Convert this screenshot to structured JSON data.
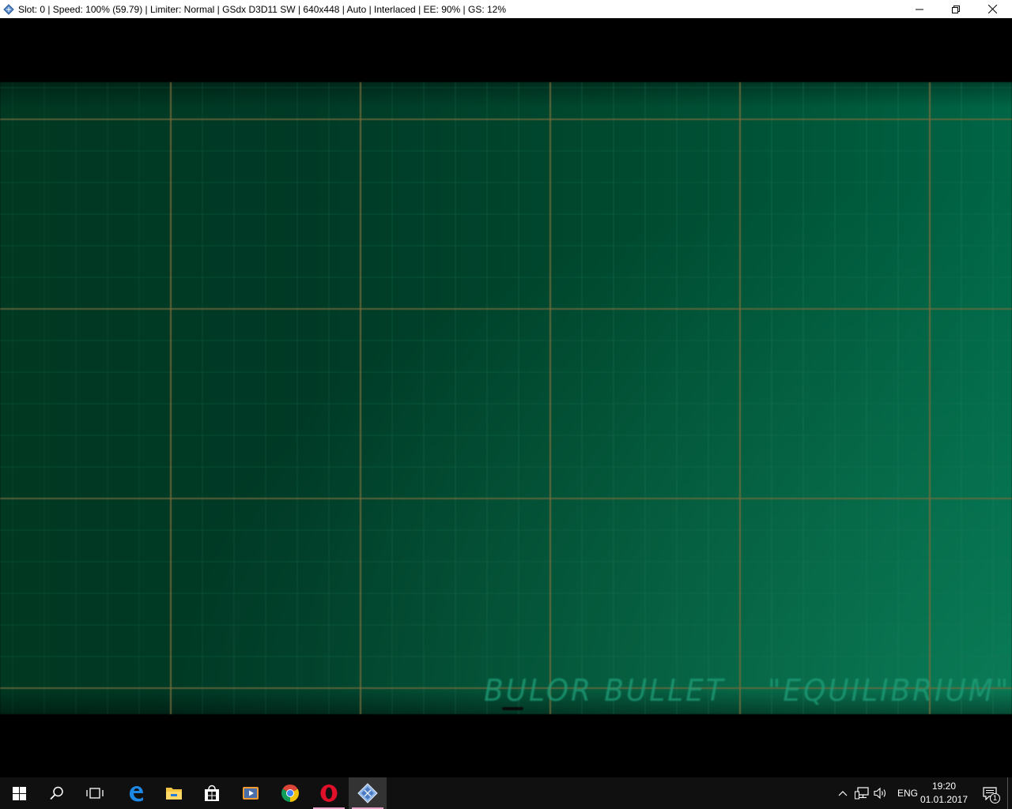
{
  "window": {
    "title": "Slot: 0 | Speed: 100% (59.79) | Limiter: Normal | GSdx D3D11 SW | 640x448 | Auto | Interlaced | EE:  90% | GS:  12%",
    "icon": "pcsx2-app-icon",
    "controls": [
      "minimize-icon",
      "restore-icon",
      "close-icon"
    ]
  },
  "game": {
    "caption_left": "BULOR BULLET",
    "caption_right": "\"EQUILIBRIUM\"",
    "colors": {
      "background_dark": "#003822",
      "background_light": "#006646",
      "grid_major": "#7a6a3a",
      "grid_minor": "#1f7a5a",
      "caption": "#1f9f7a"
    }
  },
  "taskbar": {
    "items": [
      {
        "icon": "windows-start-icon",
        "running": false
      },
      {
        "icon": "search-icon",
        "running": false
      },
      {
        "icon": "task-view-icon",
        "running": false
      },
      {
        "icon": "edge-icon",
        "running": false
      },
      {
        "icon": "file-explorer-icon",
        "running": false
      },
      {
        "icon": "store-icon",
        "running": false
      },
      {
        "icon": "media-player-icon",
        "running": false
      },
      {
        "icon": "chrome-icon",
        "running": false
      },
      {
        "icon": "opera-icon",
        "running": true
      },
      {
        "icon": "pcsx2-icon",
        "running": true,
        "active": true
      }
    ],
    "tray": {
      "icons": [
        "chevron-up-icon",
        "network-icon",
        "volume-icon"
      ],
      "language": "ENG",
      "time": "19:20",
      "date": "01.01.2017",
      "notification_count": "1"
    },
    "colors": {
      "background": "#101010",
      "running_indicator": "#e8a4c8"
    }
  }
}
